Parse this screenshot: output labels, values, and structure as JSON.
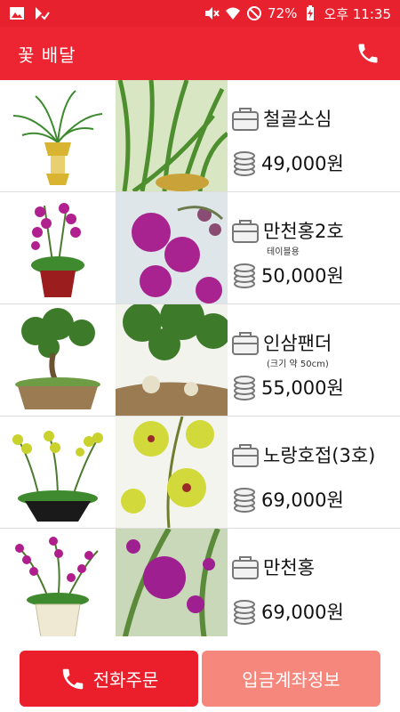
{
  "status_bar": {
    "battery": "72%",
    "time": "오후 11:35"
  },
  "app_bar": {
    "title": "꽃 배달"
  },
  "products": [
    {
      "name": "철골소심",
      "note": "",
      "price": "49,000원"
    },
    {
      "name": "만천홍2호",
      "note": "테이블용",
      "price": "50,000원"
    },
    {
      "name": "인삼팬더",
      "note": "(크기 약 50cm)",
      "price": "55,000원"
    },
    {
      "name": "노랑호접(3호)",
      "note": "",
      "price": "69,000원"
    },
    {
      "name": "만천홍",
      "note": "",
      "price": "69,000원"
    }
  ],
  "bottom": {
    "call_label": "전화주문",
    "account_label": "입금계좌정보"
  },
  "colors": {
    "primary": "#ed2431",
    "secondary_button": "#f6877d"
  }
}
